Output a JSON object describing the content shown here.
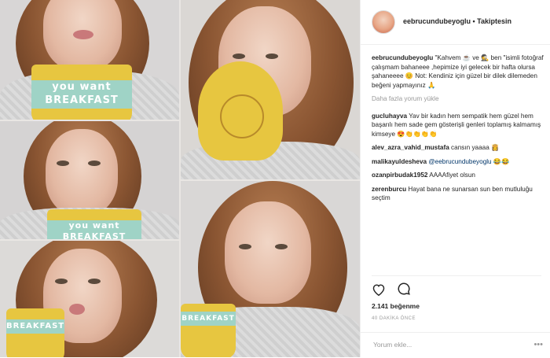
{
  "header": {
    "username": "eebrucundubeyoglu",
    "separator": " • ",
    "follow_status": "Takiptesin"
  },
  "caption": {
    "username": "eebrucundubeyoglu",
    "text": " \"Kahvem ☕ ve 🕵 ben \"isimli fotoğraf çalışmam bahaneee ,hepimize iyi gelecek bir hafta olursa şahaneeee 😊 Not: Kendiniz için güzel bir dilek dilemeden beğeni yapmayınız 🙏"
  },
  "load_more_label": "Daha fazla yorum yükle",
  "comments": [
    {
      "username": "gucluhayva",
      "text": " Yav bir kadın hem sempatik hem güzel hem başarılı hem sade gem gösterişli genleri toplamış kalmamış kimseye 😍👏👏👏👏"
    },
    {
      "username": "alev_azra_vahid_mustafa",
      "text": " cansın yaaaa 👸"
    },
    {
      "username": "malikayuldesheva",
      "mention": "@eebrucundubeyoglu",
      "text": " 😂😂"
    },
    {
      "username": "ozanpirbudak1952",
      "text": " AAAAfiyet olsun"
    },
    {
      "username": "zerenburcu",
      "text": " Hayat bana ne sunarsan sun ben mutluluğu seçtim"
    }
  ],
  "actions": {
    "like_icon": "♡",
    "comment_icon": "◯"
  },
  "likes_text": "2.141 beğenme",
  "time_text": "40 DAKİKA ÖNCE",
  "add_comment": {
    "placeholder": "Yorum ekle...",
    "more_icon": "•••"
  },
  "mug_text": {
    "line1": "you want",
    "line2": "BREAKFAST"
  },
  "colors": {
    "accent": "#003569",
    "muted": "#999999",
    "mug_yellow": "#e7c640",
    "mug_band": "#9fd3c6"
  }
}
